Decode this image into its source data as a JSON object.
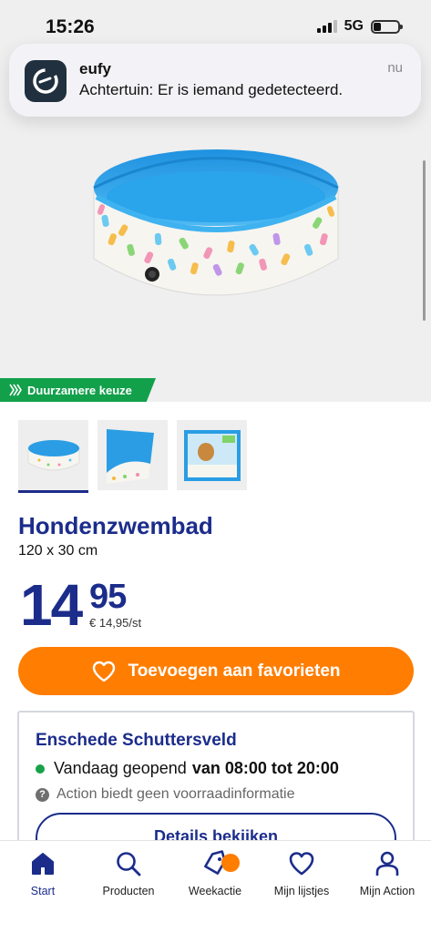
{
  "status_bar": {
    "time": "15:26",
    "network": "5G"
  },
  "notification": {
    "app": "eufy",
    "message": "Achtertuin: Er is iemand gedetecteerd.",
    "time": "nu"
  },
  "badge": {
    "label": "Duurzamere keuze",
    "color": "#13a04b"
  },
  "thumbnails": [
    {
      "name": "pool-overview",
      "active": true
    },
    {
      "name": "pool-detail",
      "active": false
    },
    {
      "name": "pool-packaging",
      "active": false
    }
  ],
  "product": {
    "title": "Hondenzwembad",
    "size": "120 x 30 cm"
  },
  "price": {
    "integer": "14",
    "decimals": "95",
    "unit_price": "€ 14,95/st"
  },
  "favorite_button": {
    "label": "Toevoegen aan favorieten"
  },
  "store": {
    "name": "Enschede Schuttersveld",
    "status": "Vandaag geopend",
    "hours": "van 08:00 tot 20:00",
    "info": "Action biedt geen voorraadinformatie",
    "details_button": "Details bekijken"
  },
  "tabbar": [
    {
      "label": "Start",
      "icon": "home-icon",
      "active": true
    },
    {
      "label": "Producten",
      "icon": "search-icon",
      "active": false
    },
    {
      "label": "Weekactie",
      "icon": "tag-icon",
      "active": false
    },
    {
      "label": "Mijn lijstjes",
      "icon": "heart-icon",
      "active": false
    },
    {
      "label": "Mijn Action",
      "icon": "user-icon",
      "active": false
    }
  ],
  "colors": {
    "brand_blue": "#1b2c8b",
    "accent_orange": "#ff7d00",
    "pool_blue": "#2a9de4",
    "open_green": "#17a24a"
  }
}
